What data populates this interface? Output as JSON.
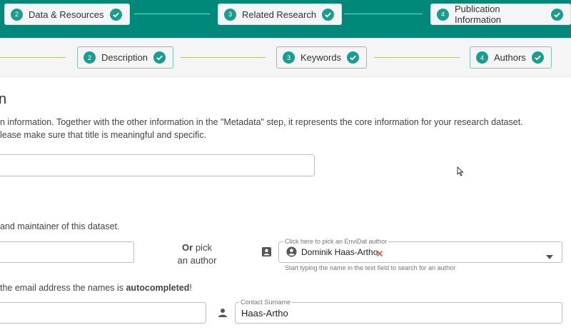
{
  "top_steps": [
    {
      "number": "2",
      "label": "Data & Resources"
    },
    {
      "number": "3",
      "label": "Related Research"
    },
    {
      "number": "4",
      "label": "Publication Information"
    }
  ],
  "sub_steps": [
    {
      "number": "2",
      "label": "Description"
    },
    {
      "number": "3",
      "label": "Keywords"
    },
    {
      "number": "4",
      "label": "Authors"
    }
  ],
  "section": {
    "heading_fragment": "n",
    "intro_line1": "n information. Together with the other information in the \"Metadata\" step, it represents the core information for your research dataset.",
    "intro_line2": "lease make sure that title is meaningful and specific.",
    "contact_line": "and maintainer of this dataset.",
    "autocomplete_prefix": "the email address the names is ",
    "autocomplete_bold": "autocompleted",
    "autocomplete_suffix": "!"
  },
  "picker": {
    "or_label": "Or",
    "pick_label": "pick",
    "author_label": "an author",
    "field_label": "Click here to pick an EnviDat author",
    "selected_author": "Dominik Haas-Artho",
    "hint": "Start typing the name in the text field to search for an author"
  },
  "contact_surname": {
    "label": "Contact Surname",
    "value": "Haas-Artho"
  },
  "colors": {
    "header": "#00897b",
    "step_badge": "#1a9d8f",
    "connector": "#a9cc7a"
  }
}
